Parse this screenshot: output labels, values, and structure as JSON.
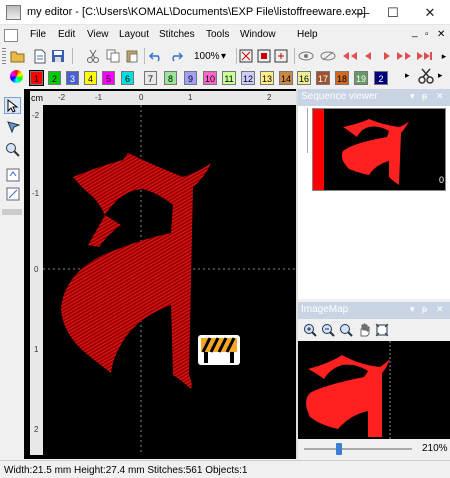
{
  "window": {
    "title": "my editor - [C:\\Users\\KOMAL\\Documents\\EXP File\\listoffreeware.exp]",
    "controls": {
      "minimize": "—",
      "maximize": "☐",
      "close": "✕"
    }
  },
  "menu": {
    "items": [
      "File",
      "Edit",
      "View",
      "Layout",
      "Stitches",
      "Tools",
      "Window",
      "Help"
    ],
    "window_controls": {
      "minimize": "_",
      "restore": "▫",
      "close": "✕"
    }
  },
  "toolbar": {
    "zoom_value": "100%",
    "zoom_arrow": "▾",
    "overflow": "▸"
  },
  "colorbar": {
    "swatches": [
      {
        "label": "1",
        "color": "#ff0000"
      },
      {
        "label": "2",
        "color": "#00cc00"
      },
      {
        "label": "3",
        "color": "#4a5fd0"
      },
      {
        "label": "4",
        "color": "#ffff00"
      },
      {
        "label": "5",
        "color": "#ff00ff"
      },
      {
        "label": "6",
        "color": "#00e0e0"
      },
      {
        "label": "7",
        "color": "#e8e8e8"
      },
      {
        "label": "8",
        "color": "#99e699"
      },
      {
        "label": "9",
        "color": "#a0a0ff"
      },
      {
        "label": "10",
        "color": "#ff66cc"
      },
      {
        "label": "11",
        "color": "#ccff99"
      },
      {
        "label": "12",
        "color": "#ccccff"
      },
      {
        "label": "13",
        "color": "#ffee88"
      },
      {
        "label": "14",
        "color": "#cc8844"
      },
      {
        "label": "16",
        "color": "#eeee99"
      },
      {
        "label": "17",
        "color": "#a0522d"
      },
      {
        "label": "18",
        "color": "#d2691e"
      },
      {
        "label": "19",
        "color": "#669966"
      },
      {
        "label": "2",
        "color": "#000080"
      }
    ],
    "overflow": "▸"
  },
  "ruler": {
    "unit": "cm",
    "h_ticks": [
      "-2",
      "-1",
      "0",
      "1",
      "2"
    ],
    "v_ticks": [
      "-2",
      "-1",
      "0",
      "1",
      "2"
    ]
  },
  "sequence_viewer": {
    "title": "Sequence viewer",
    "item_index": "0",
    "thread_color": "#ff0000"
  },
  "image_map": {
    "title": "ImageMap",
    "zoom_label": "210%"
  },
  "design": {
    "thread_color": "#ff0000",
    "warning_icon": "construction-barrier-icon"
  },
  "status": {
    "text": "Width:21.5 mm  Height:27.4 mm  Stitches:561  Objects:1"
  }
}
